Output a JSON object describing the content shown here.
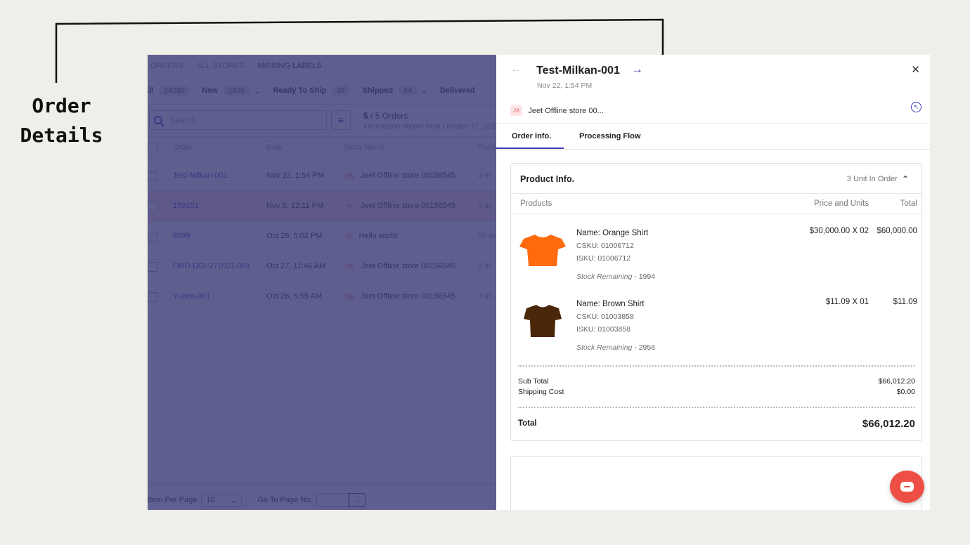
{
  "annotation": {
    "line1": "Order",
    "line2": "Details"
  },
  "list": {
    "breadcrumb": [
      "ORDERS",
      "ALL STORES",
      "MISSING LABELS"
    ],
    "status_tabs": [
      {
        "label": "All",
        "count": "24236"
      },
      {
        "label": "New",
        "count": "1536",
        "dropdown": "⌄"
      },
      {
        "label": "Ready To Ship",
        "count": "38"
      },
      {
        "label": "Shipped",
        "count": "84",
        "dropdown": "⌄"
      },
      {
        "label": "Delivered"
      }
    ],
    "search_placeholder": "Search",
    "order_count_current": "5",
    "order_count_text": "/ 5 Orders",
    "info_text": "Information shown from October 17, 202",
    "columns": [
      "Order",
      "Date",
      "Store Name",
      "Produ"
    ],
    "rows": [
      {
        "order": "Test-Milkan-001",
        "date": "Nov 22, 1:54 PM",
        "store_initials": "YA",
        "store": "Jeet Offline store 00156545",
        "products": "3 In"
      },
      {
        "order": "159151",
        "date": "Nov 5, 12:11 PM",
        "store_initials": "YA",
        "store": "Jeet Offline store 00156545",
        "products": "4 In"
      },
      {
        "order": "8899",
        "date": "Oct 29, 5:02 PM",
        "store_initials": "YI",
        "store": "Hello world",
        "products": "50 In"
      },
      {
        "order": "ORD-DGI-271021-001",
        "date": "Oct 27, 11:46 AM",
        "store_initials": "YA",
        "store": "Jeet Offline store 00156545",
        "products": "2 In"
      },
      {
        "order": "Yudea-001",
        "date": "Oct 26, 5:55 AM",
        "store_initials": "YA",
        "store": "Jeet Offline store 00156545",
        "products": "3 In"
      }
    ],
    "footer": {
      "per_page_label": "Item Per Page",
      "per_page_value": "10",
      "goto_label": "Go To Page No."
    }
  },
  "detail": {
    "order_id": "Test-Milkan-001",
    "date": "Nov 22, 1:54 PM",
    "store_initials": "JA",
    "store_name": "Jeet Offline store 00...",
    "tabs": [
      "Order Info.",
      "Processing Flow"
    ],
    "product_info_title": "Product Info.",
    "units_text": "3 Unit In Order",
    "col_products": "Products",
    "col_price_units": "Price and Units",
    "col_total": "Total",
    "products": [
      {
        "name": "Name: Orange Shirt",
        "csku": "CSKU: 01006712",
        "isku": "ISKU:  01006712",
        "stock_label": "Stock Remaining",
        "stock_value": " - 1994",
        "price_units": "$30,000.00 X 02",
        "total": "$60,000.00",
        "color": "#ff6a0d"
      },
      {
        "name": "Name: Brown Shirt",
        "csku": "CSKU: 01003858",
        "isku": "ISKU:  01003858",
        "stock_label": "Stock Remaining",
        "stock_value": " - 2956",
        "price_units": "$11.09 X 01",
        "total": "$11.09",
        "color": "#4a2708"
      }
    ],
    "sub_total_label": "Sub Total",
    "sub_total": "$66,012.20",
    "shipping_label": "Shipping Cost",
    "shipping": "$0.00",
    "total_label": "Total",
    "total": "$66,012.20"
  },
  "colors": {
    "accent": "#3d3dbf",
    "chat": "#ee4f44",
    "overlay": "#373773"
  }
}
